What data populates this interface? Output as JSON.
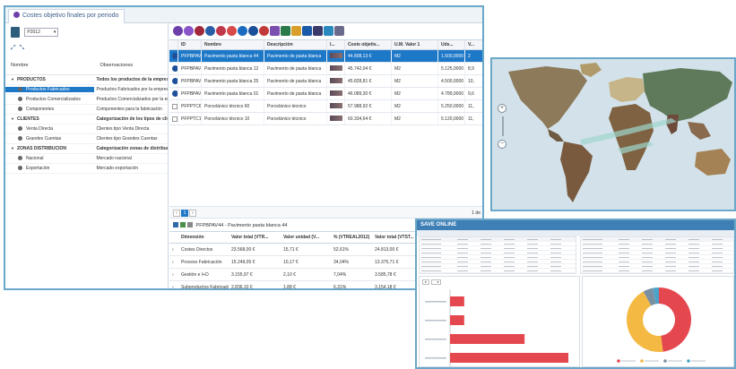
{
  "main_window": {
    "tab_title": "Costes objetivo finales por periodo",
    "period": "P2012",
    "tree": {
      "col_name": "Nombre",
      "col_obs": "Observaciones",
      "rows": [
        {
          "name": "PRODUCTOS",
          "obs": "Todos los productos de la empresa",
          "kind": "group"
        },
        {
          "name": "Productos Fabricados",
          "obs": "Productos Fabricados por la empresa",
          "kind": "selected"
        },
        {
          "name": "Productos Comercializados",
          "obs": "Productos Comercializados por la empr",
          "kind": "item"
        },
        {
          "name": "Componentes",
          "obs": "Componentes para la fabricación",
          "kind": "item"
        },
        {
          "name": "CLIENTES",
          "obs": "Categorización de los tipos de clientes",
          "kind": "group"
        },
        {
          "name": "Venta Directa",
          "obs": "Clientes tipo Venta Directa",
          "kind": "item"
        },
        {
          "name": "Grandes Cuentas",
          "obs": "Clientes tipo Grandes Cuentas",
          "kind": "item"
        },
        {
          "name": "ZONAS DISTRIBUCIÓN",
          "obs": "Categorización zonas de distribución",
          "kind": "group"
        },
        {
          "name": "Nacional",
          "obs": "Mercado nacional",
          "kind": "item"
        },
        {
          "name": "Exportación",
          "obs": "Mercado exportación",
          "kind": "item"
        }
      ]
    },
    "grid": {
      "headers": [
        "",
        "ID",
        "Nombre",
        "Descripción",
        "I...",
        "Coste objetiv...",
        "U.M. Valor 1",
        "Uds...",
        "V..."
      ],
      "rows": [
        {
          "id": "PFPBPAV44",
          "nombre": "Pavimento pasta blanca 44",
          "desc": "Pavimento de pasta blanca",
          "coste": "44.808,13 €",
          "um": "M2",
          "uds": "1.500,0000",
          "v": "2",
          "flag": "info",
          "selected": true
        },
        {
          "id": "PFPBPAV12",
          "nombre": "Pavimento pasta blanca 12",
          "desc": "Pavimento de pasta blanca",
          "coste": "45.742,04 €",
          "um": "M2",
          "uds": "5.125,0000",
          "v": "8,9",
          "flag": "info",
          "selected": false
        },
        {
          "id": "PFPBPAV25",
          "nombre": "Pavimento pasta blanca 25",
          "desc": "Pavimento de pasta blanca",
          "coste": "45.828,81 €",
          "um": "M2",
          "uds": "4.500,0000",
          "v": "10,",
          "flag": "info",
          "selected": false
        },
        {
          "id": "PFPBPAV01",
          "nombre": "Pavimento pasta blanca 01",
          "desc": "Pavimento de pasta blanca",
          "coste": "46.089,30 €",
          "um": "M2",
          "uds": "4.789,0000",
          "v": "9,6",
          "flag": "info",
          "selected": false
        },
        {
          "id": "PFPPTC60",
          "nombre": "Porcelánico técnico 60",
          "desc": "Porcelánico técnico",
          "coste": "57.988,92 €",
          "um": "M2",
          "uds": "5.250,0000",
          "v": "11,",
          "flag": "check",
          "selected": false
        },
        {
          "id": "PFPPTC10",
          "nombre": "Porcelánico técnico 10",
          "desc": "Porcelánico técnico",
          "coste": "60.334,64 €",
          "um": "M2",
          "uds": "5.120,0000",
          "v": "11,",
          "flag": "check",
          "selected": false
        }
      ]
    },
    "pager": {
      "current": "1",
      "right_text": "1 de"
    },
    "detail": {
      "title": "PFPBPAV44 - Pavimento pasta blanca 44",
      "headers": [
        "",
        "Dimensión",
        "Valor total (VTR...",
        "Valor unidad (V...",
        "% (VTREAL2012)",
        "Valor total (VTST...",
        "Valor total (VTSTD2012)"
      ],
      "rows": [
        {
          "dim": "Costes Directos",
          "vt": "23.568,00 €",
          "vu": "15,71 €",
          "pct": "52,61%",
          "vs": "24.813,00 €"
        },
        {
          "dim": "Proceso Fabricación",
          "vt": "15.249,05 €",
          "vu": "10,17 €",
          "pct": "34,04%",
          "vs": "13.375,71 €"
        },
        {
          "dim": "Gestión e I+D",
          "vt": "3.155,97 €",
          "vu": "2,10 €",
          "pct": "7,04%",
          "vs": "3.585,78 €"
        },
        {
          "dim": "Subproductos Fabricados",
          "vt": "2.836,10 €",
          "vu": "1,88 €",
          "pct": "6,31%",
          "vs": "3.154,18 €"
        }
      ]
    }
  },
  "bi_window": {
    "title": "SAVE ONLINE",
    "bar_chart": {
      "categories": [
        "Cat. 1",
        "Cat. 2",
        "Cat. 3",
        "Cat. 4"
      ],
      "values": [
        12,
        12,
        63,
        100
      ],
      "color": "#e5474f"
    },
    "donut_chart": {
      "values": [
        48,
        44,
        5,
        3
      ],
      "colors": [
        "#e5474f",
        "#f4b942",
        "#7b8fa3",
        "#4aa3c9"
      ]
    }
  },
  "colors": {
    "accent": "#1e78c8",
    "frame": "#6aa7c9",
    "bi_header": "#3e7fb6"
  }
}
